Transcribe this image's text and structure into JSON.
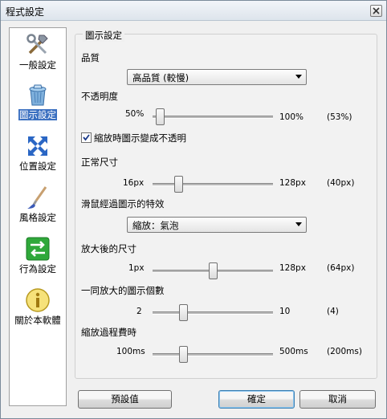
{
  "window": {
    "title": "程式設定"
  },
  "sidebar": {
    "items": [
      {
        "label": "一般設定",
        "icon": "tools-icon"
      },
      {
        "label": "圖示設定",
        "icon": "recycle-bin-icon"
      },
      {
        "label": "位置設定",
        "icon": "move-arrows-icon"
      },
      {
        "label": "風格設定",
        "icon": "paintbrush-icon"
      },
      {
        "label": "行為設定",
        "icon": "swap-arrows-icon"
      },
      {
        "label": "關於本軟體",
        "icon": "info-icon"
      }
    ],
    "selected": "圖示設定"
  },
  "group": {
    "title": "圖示設定"
  },
  "quality": {
    "label": "品質",
    "value": "高品質 (較慢)"
  },
  "opacity": {
    "label": "不透明度",
    "min": "50%",
    "max": "100%",
    "current": "(53%)",
    "fraction": 0.06
  },
  "zoom_checkbox": {
    "label": "縮放時圖示變成不透明",
    "checked": true
  },
  "normal_size": {
    "label": "正常尺寸",
    "min": "16px",
    "max": "128px",
    "current": "(40px)",
    "fraction": 0.21
  },
  "hover_effect": {
    "label": "滑鼠經過圖示的特效",
    "value": "縮放：氣泡"
  },
  "enlarged_size": {
    "label": "放大後的尺寸",
    "min": "1px",
    "max": "128px",
    "current": "(64px)",
    "fraction": 0.5
  },
  "icon_count": {
    "label": "一同放大的圖示個數",
    "min": "2",
    "max": "10",
    "current": "(4)",
    "fraction": 0.25
  },
  "zoom_time": {
    "label": "縮放過程費時",
    "min": "100ms",
    "max": "500ms",
    "current": "(200ms)",
    "fraction": 0.25
  },
  "buttons": {
    "defaults": "預設值",
    "ok": "確定",
    "cancel": "取消"
  }
}
